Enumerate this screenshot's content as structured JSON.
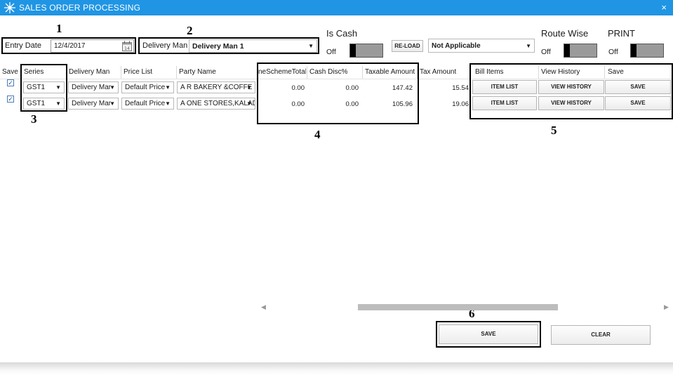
{
  "window": {
    "title": "SALES ORDER PROCESSING",
    "close_glyph": "×",
    "logo_icon": "burst-logo-icon"
  },
  "callouts": [
    "1",
    "2",
    "3",
    "4",
    "5",
    "6"
  ],
  "entry_date": {
    "label": "Entry Date",
    "value": "12/4/2017",
    "icon": "calendar-icon"
  },
  "delivery_man": {
    "label": "Delivery Man",
    "value": "Delivery Man 1"
  },
  "is_cash": {
    "label": "Is Cash",
    "state": "Off"
  },
  "reload_label": "RE-LOAD",
  "applicability": {
    "value": "Not Applicable"
  },
  "route_wise": {
    "label": "Route Wise",
    "state": "Off"
  },
  "print": {
    "label": "PRINT",
    "state": "Off"
  },
  "table": {
    "headers": [
      "Save",
      "Series",
      "Delivery Man",
      "Price List",
      "Party Name",
      "neSchemeTotal",
      "Cash Disc%",
      "Taxable Amount",
      "Tax Amount",
      "Bill Items",
      "View History",
      "Save"
    ],
    "rows": [
      {
        "checked": true,
        "series": "GST1",
        "delivery_man": "Delivery Mar",
        "price_list": "Default Price",
        "party": "A R BAKERY &COFFE SI",
        "scheme_total": "0.00",
        "cash_disc": "0.00",
        "taxable": "147.42",
        "tax": "15.54",
        "item_list": "ITEM LIST",
        "view_history": "VIEW HISTORY",
        "save": "SAVE"
      },
      {
        "checked": true,
        "series": "GST1",
        "delivery_man": "Delivery Mar",
        "price_list": "Default Price",
        "party": "A ONE STORES,KALADY",
        "scheme_total": "0.00",
        "cash_disc": "0.00",
        "taxable": "105.96",
        "tax": "19.06",
        "item_list": "ITEM LIST",
        "view_history": "VIEW HISTORY",
        "save": "SAVE"
      }
    ]
  },
  "scroll": {
    "left_glyph": "◀",
    "right_glyph": "▶"
  },
  "footer": {
    "save_label": "SAVE",
    "clear_label": "CLEAR"
  },
  "colors": {
    "titlebar": "#1f95e4",
    "callout_border": "#000000"
  }
}
